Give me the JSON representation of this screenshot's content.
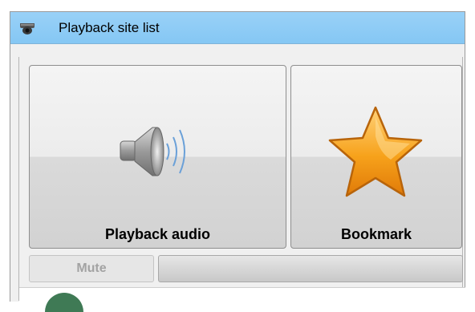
{
  "window": {
    "title": "Playback site list",
    "icon": "camera-icon"
  },
  "buttons": {
    "playback_audio": {
      "label": "Playback audio",
      "icon": "speaker-icon"
    },
    "bookmark": {
      "label": "Bookmark",
      "icon": "star-icon"
    },
    "mute": {
      "label": "Mute",
      "enabled": false
    }
  },
  "audio_level": {
    "fraction": 0.0
  },
  "colors": {
    "titlebar": "#8ccbf5",
    "star_fill": "#f7a21b",
    "disabled_text": "#a3a3a3"
  }
}
